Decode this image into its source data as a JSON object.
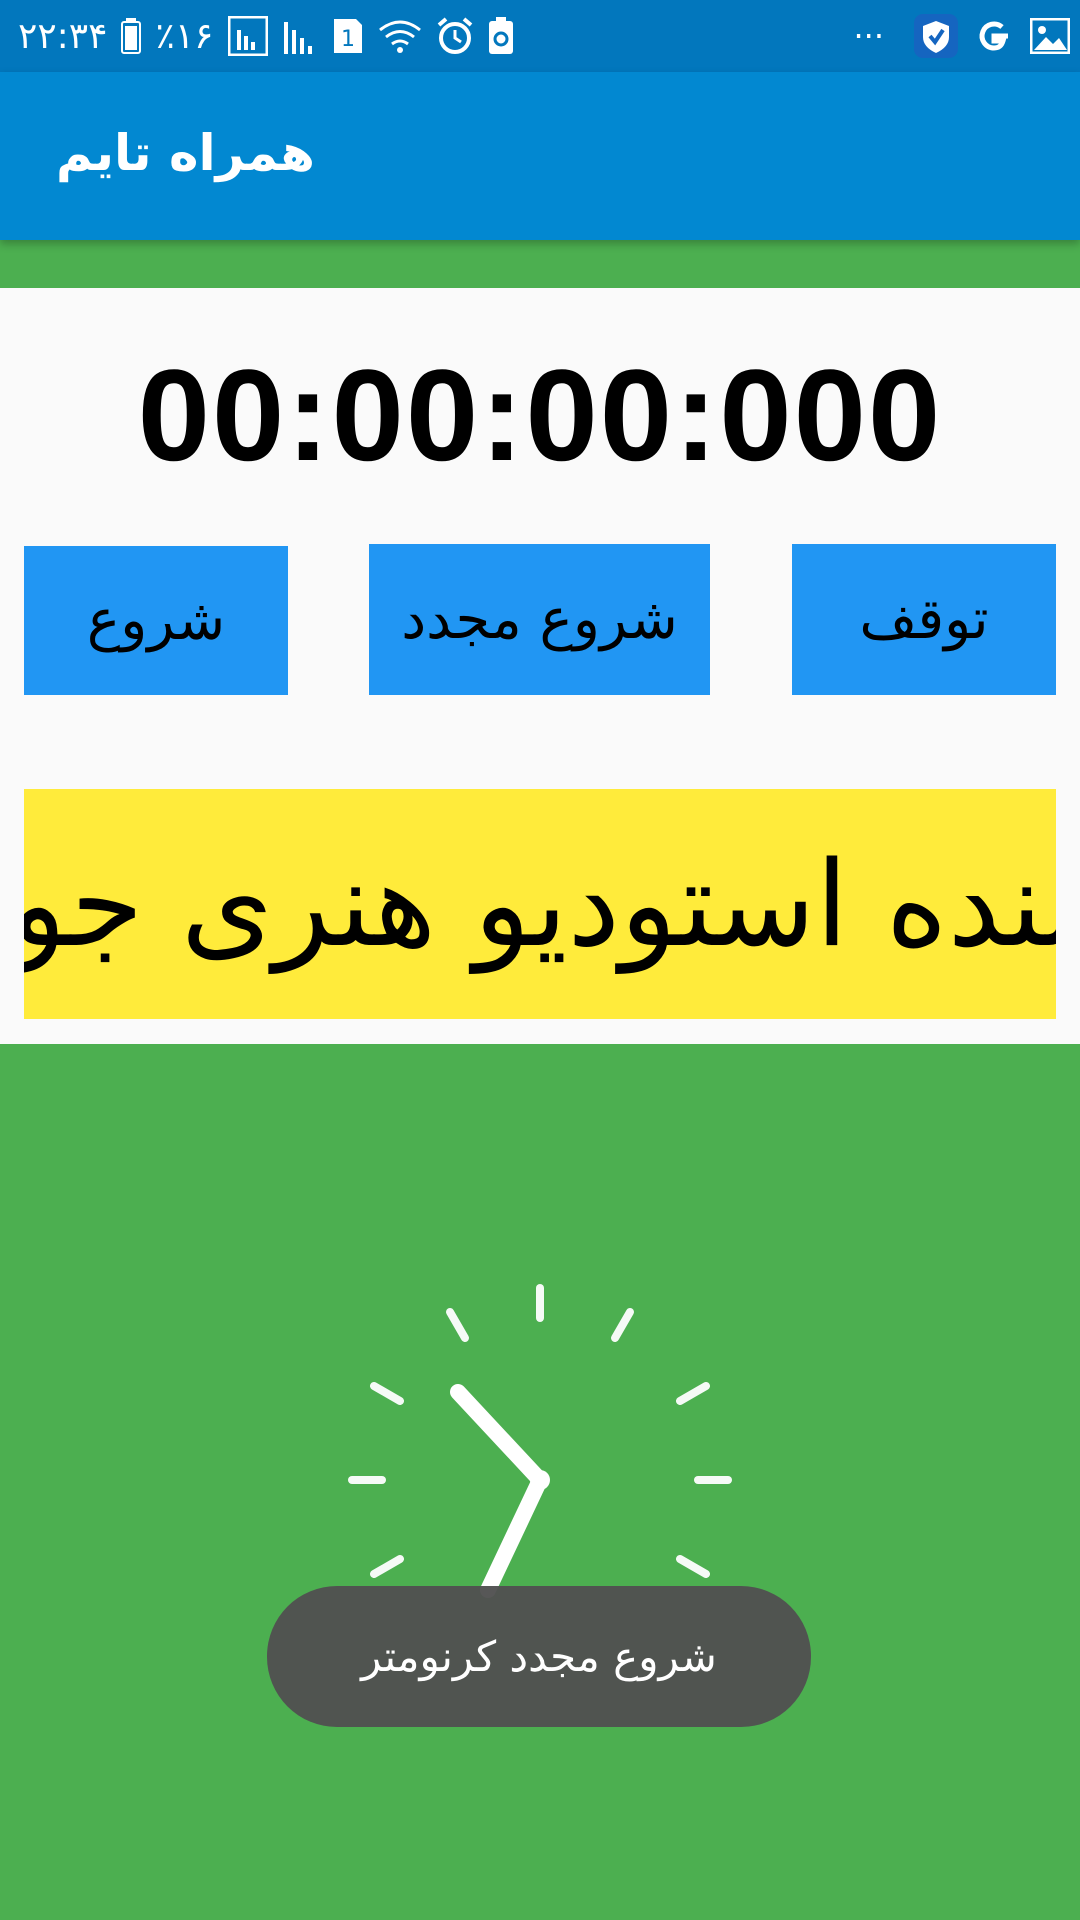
{
  "status_bar": {
    "time": "۲۲:۳۴",
    "battery": "٪۱۶",
    "sim_number": "1",
    "overflow": "···"
  },
  "app_bar": {
    "title": "همراه تایم"
  },
  "timer": {
    "display": "00:00:00:000"
  },
  "buttons": {
    "stop_label": "توقف",
    "restart_label": "شروع مجدد",
    "start_label": "شروع"
  },
  "banner": {
    "text": "بنده استودیو هنری جو"
  },
  "toast": {
    "message": "شروع مجدد کرنومتر"
  },
  "colors": {
    "status_bar": "#0277bd",
    "app_bar": "#0288d1",
    "background": "#4caf50",
    "button": "#2196f3",
    "banner": "#ffeb3b",
    "toast": "#555555"
  },
  "icons": [
    "battery-icon",
    "signal-icon",
    "sim-icon",
    "wifi-icon",
    "alarm-icon",
    "recycle-icon",
    "shield-app-icon",
    "google-icon",
    "gallery-icon",
    "clock-loading-icon"
  ]
}
